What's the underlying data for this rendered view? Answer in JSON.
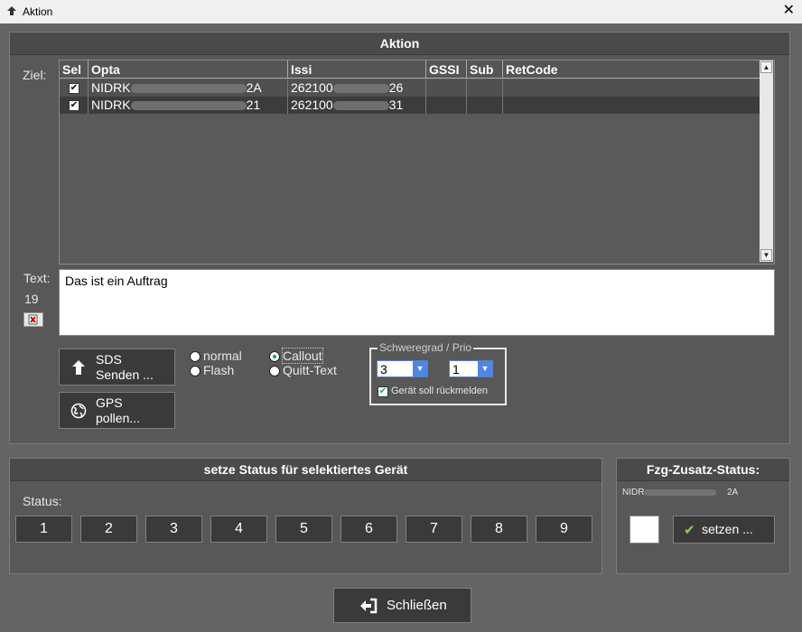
{
  "window": {
    "title": "Aktion",
    "close": "✕"
  },
  "aktion": {
    "title": "Aktion",
    "ziel_label": "Ziel:",
    "columns": [
      "Sel",
      "Opta",
      "Issi",
      "GSSI",
      "Sub",
      "RetCode"
    ],
    "rows": [
      {
        "sel": true,
        "opta_prefix": "NIDRK",
        "opta_suffix": "2A",
        "issi_prefix": "262100",
        "issi_suffix": "26"
      },
      {
        "sel": true,
        "opta_prefix": "NIDRK",
        "opta_suffix": "21",
        "issi_prefix": "262100",
        "issi_suffix": "31"
      }
    ],
    "text_label": "Text:",
    "char_count": "19",
    "text_value": "Das ist ein Auftrag",
    "sds_button": "SDS\nSenden ...",
    "gps_button": "GPS\npollen...",
    "radio_normal": "normal",
    "radio_flash": "Flash",
    "radio_callout": "Callout",
    "radio_quitt": "Quitt-Text",
    "schweregrad_legend": "Schweregrad / Prio",
    "schweregrad_value": "3",
    "prio_value": "1",
    "rueckmelden_label": "Gerät soll rückmelden"
  },
  "status_panel": {
    "title": "setze Status für selektiertes Gerät",
    "status_label": "Status:",
    "buttons": [
      "1",
      "2",
      "3",
      "4",
      "5",
      "6",
      "7",
      "8",
      "9"
    ]
  },
  "zusatz_panel": {
    "title": "Fzg-Zusatz-Status:",
    "device_prefix": "NIDR",
    "device_suffix": "2A",
    "setzen_button": "setzen ..."
  },
  "close_button": "Schließen"
}
